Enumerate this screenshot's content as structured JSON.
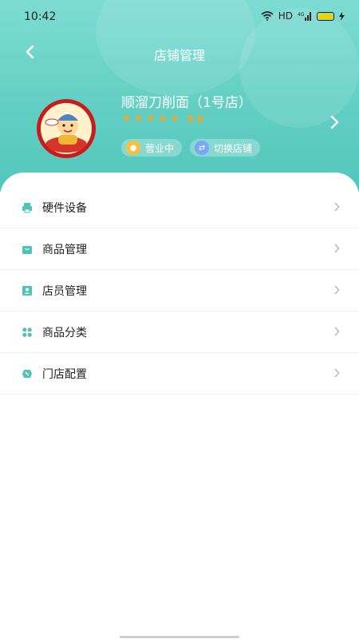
{
  "status_bar": {
    "time": "10:42",
    "network": "HD",
    "signal_text": "4G"
  },
  "nav": {
    "title": "店铺管理"
  },
  "store": {
    "name": "顺溜刀削面（1号店）",
    "rating": "5.0",
    "stars": 5,
    "status_label": "营业中",
    "switch_label": "切换店铺"
  },
  "menu": [
    {
      "label": "硬件设备",
      "icon": "printer-icon"
    },
    {
      "label": "商品管理",
      "icon": "shopping-bag-icon"
    },
    {
      "label": "店员管理",
      "icon": "staff-badge-icon"
    },
    {
      "label": "商品分类",
      "icon": "category-grid-icon"
    },
    {
      "label": "门店配置",
      "icon": "store-settings-icon"
    }
  ],
  "colors": {
    "header_gradient_top": "#7ddcd3",
    "header_gradient_bottom": "#52c6ba",
    "accent_teal": "#4fc3b7",
    "star": "#f5a623"
  }
}
